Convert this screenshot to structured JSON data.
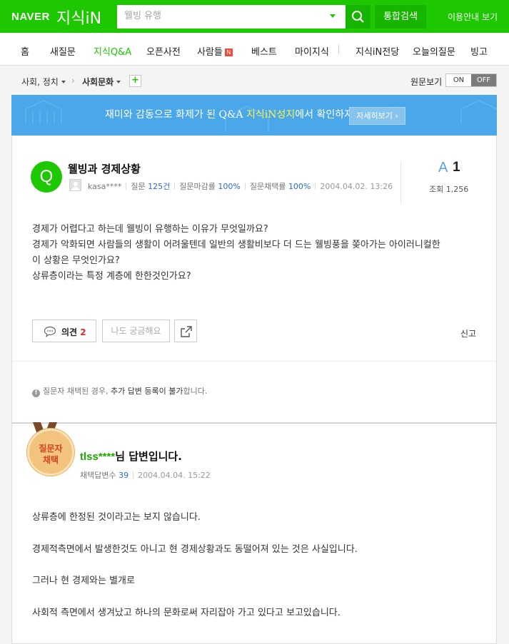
{
  "header": {
    "logo": "NAVER",
    "service": "지식iN",
    "search_placeholder": "웰빙 유행",
    "search_button_icon": "search-icon",
    "total_search_label": "통합검색",
    "guide_label": "이용안내 보기"
  },
  "nav": {
    "items": [
      "홈",
      "새질문",
      "지식Q&A",
      "오픈사전",
      "사람들",
      "베스트",
      "마이지식",
      "지식iN전당",
      "오늘의질문",
      "빙고"
    ],
    "active": "지식Q&A",
    "new_badge": "N"
  },
  "breadcrumb": {
    "category": "사회, 정치",
    "subcategory": "사회문화",
    "add_label": "+",
    "original_view_label": "원문보기",
    "toggle_on": "ON",
    "toggle_off": "OFF"
  },
  "banner": {
    "text_before": "재미와 감동으로 화제가 된 Q&A ",
    "highlight": "지식iN성지",
    "text_after": "에서 확인하자!",
    "button_label": "자세히보기 ›"
  },
  "question": {
    "badge": "Q",
    "title": "웰빙과 경제상황",
    "author": "kasa****",
    "question_label": "질문",
    "question_count": "125건",
    "close_rate_label": "질문마감률",
    "close_rate": "100%",
    "adopt_rate_label": "질문채택률",
    "adopt_rate": "100%",
    "date": "2004.04.02. 13:26",
    "answer_label": "A",
    "answer_count": "1",
    "views_label": "조회",
    "views": "1,256",
    "body": [
      "경제가 어렵다고 하는데 웰빙이 유행하는 이유가 무엇일까요?",
      "경제가 악화되면 사람들의 생활이 어려울텐데 일반의 생활비보다 더 드는 웰빙풍을 쫒아가는 아이러니컬한",
      "이 상황은 무엇인가요?",
      "상류층이라는 특정 계층에 한한것인가요?"
    ],
    "opinion_label": "의견",
    "opinion_count": "2",
    "curious_label": "나도 궁금해요",
    "report_label": "신고",
    "notice_prefix": "질문자 채택된 경우, ",
    "notice_key": "추가 답변 등록이 불가",
    "notice_suffix": "합니다."
  },
  "answer": {
    "medal_line1": "질문자",
    "medal_line2": "채택",
    "username": "tlss****",
    "title_suffix": "님 답변입니다.",
    "adopt_label": "채택답변수",
    "adopt_count": "39",
    "date": "2004.04.04. 15:22",
    "body": [
      "상류층에 한정된 것이라고는 보지 않습니다.",
      "경제적측면에서 발생한것도 아니고 현 경제상황과도 동떨어져 있는 것은 사실입니다.",
      "그러나 현 경제와는 별개로",
      "사회적 측면에서 생겨났고 하나의 문화로써 자리잡아 가고 있다고 보고있습니다."
    ]
  },
  "colors": {
    "brand_green": "#1ec800",
    "banner_blue": "#4aa7e9",
    "highlight_yellow": "#fff34f",
    "count_red": "#e4262b",
    "link_blue": "#2a6bd3"
  }
}
